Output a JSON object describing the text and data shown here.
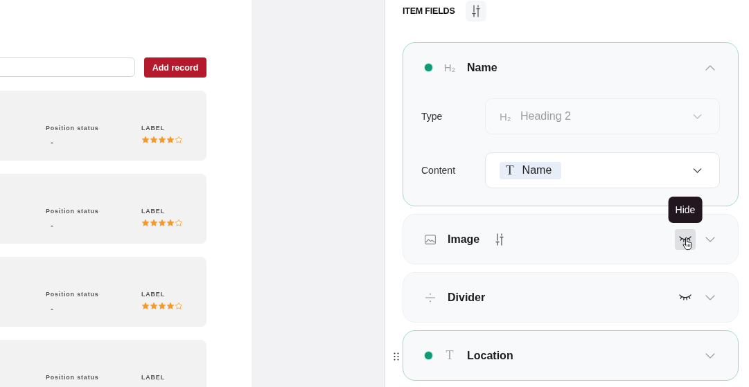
{
  "records": {
    "add_button": "Add record",
    "cards": [
      {
        "status_label": "Position status",
        "status_value": "-",
        "rating_label": "LABEL",
        "stars": 4
      },
      {
        "status_label": "Position status",
        "status_value": "-",
        "rating_label": "LABEL",
        "stars": 4
      },
      {
        "status_label": "Position status",
        "status_value": "-",
        "rating_label": "LABEL",
        "stars": 4
      },
      {
        "status_label": "Position status",
        "rating_label": "LABEL"
      }
    ]
  },
  "item_fields": {
    "title": "ITEM FIELDS",
    "fields": [
      {
        "kind": "heading",
        "label": "Name",
        "glyph": "H₂",
        "active": true,
        "expanded": true,
        "options": false,
        "hide_button": false,
        "hovered": false,
        "drag_handle": false,
        "settings": [
          {
            "kind": "select",
            "label": "Type",
            "glyph": "H₂",
            "value": "Heading 2",
            "disabled": true
          },
          {
            "kind": "chip",
            "label": "Content",
            "glyph": "T",
            "value": "Name",
            "disabled": false
          }
        ]
      },
      {
        "kind": "image",
        "label": "Image",
        "active": false,
        "expanded": false,
        "options": true,
        "hide_button": true,
        "hovered": true,
        "drag_handle": false,
        "tooltip": "Hide"
      },
      {
        "kind": "divider",
        "label": "Divider",
        "active": false,
        "expanded": false,
        "options": false,
        "hide_button": true,
        "hovered": false,
        "drag_handle": false
      },
      {
        "kind": "text",
        "label": "Location",
        "glyph": "T",
        "active": true,
        "expanded": false,
        "options": false,
        "hide_button": false,
        "hovered": false,
        "drag_handle": true
      }
    ]
  }
}
